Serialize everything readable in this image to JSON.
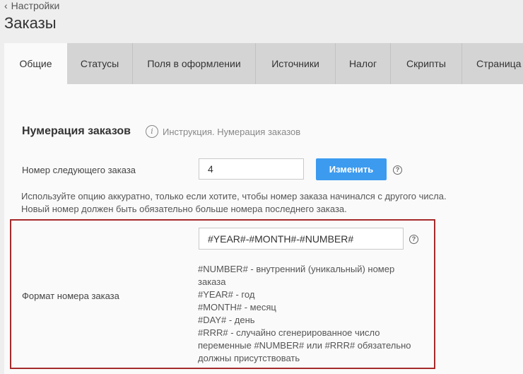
{
  "breadcrumb": {
    "icon": "chevron-left-icon",
    "label": "Настройки"
  },
  "page_title": "Заказы",
  "tabs": [
    {
      "label": "Общие",
      "active": true
    },
    {
      "label": "Статусы",
      "active": false
    },
    {
      "label": "Поля в оформлении",
      "active": false
    },
    {
      "label": "Источники",
      "active": false
    },
    {
      "label": "Налог",
      "active": false
    },
    {
      "label": "Скрипты",
      "active": false
    },
    {
      "label": "Страница",
      "active": false
    }
  ],
  "numbering": {
    "title": "Нумерация заказов",
    "instruction_link": "Инструкция. Нумерация заказов",
    "next_order_label": "Номер следующего заказа",
    "next_order_value": "4",
    "change_button": "Изменить",
    "hint_line1": "Используйте опцию аккуратно, только если хотите, чтобы номер заказа начинался с другого числа.",
    "hint_line2": "Новый номер должен быть обязательно больше номера последнего заказа.",
    "format_label": "Формат номера заказа",
    "format_value": "#YEAR#-#MONTH#-#NUMBER#",
    "variables": [
      "#NUMBER# - внутренний (уникальный) номер",
      "заказа",
      "#YEAR# - год",
      "#MONTH# - месяц",
      "#DAY# - день",
      "#RRR# - случайно сгенерированное число",
      "переменные #NUMBER# или #RRR# обязательно",
      "должны присутствовать"
    ]
  },
  "colors": {
    "accent_button": "#3c9bef",
    "highlight_border": "#a52a2a",
    "tab_bar": "#d4d4d4"
  }
}
